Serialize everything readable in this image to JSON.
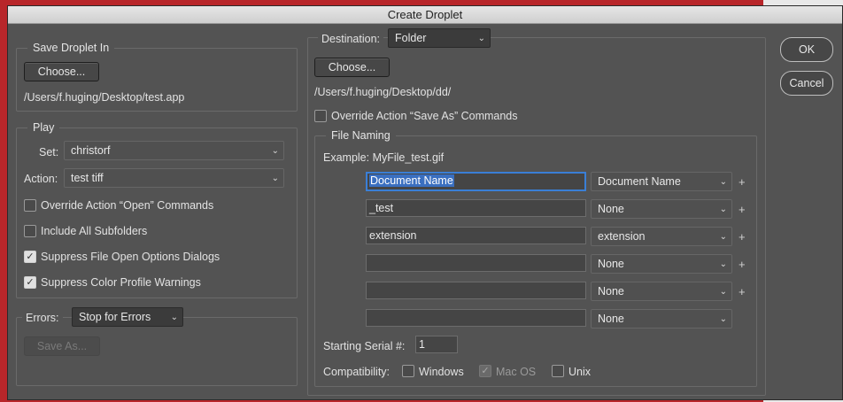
{
  "window": {
    "title": "Create Droplet"
  },
  "save_droplet": {
    "legend": "Save Droplet In",
    "choose_label": "Choose...",
    "path": "/Users/f.huging/Desktop/test.app"
  },
  "play": {
    "legend": "Play",
    "set_label": "Set:",
    "set_value": "christorf",
    "action_label": "Action:",
    "action_value": "test tiff",
    "override_open": "Override Action “Open” Commands",
    "include_subfolders": "Include All Subfolders",
    "suppress_open_options": "Suppress File Open Options Dialogs",
    "suppress_color_warnings": "Suppress Color Profile Warnings",
    "check_glyph": "✓"
  },
  "errors": {
    "label": "Errors:",
    "value": "Stop for Errors",
    "save_as_label": "Save As..."
  },
  "destination": {
    "label": "Destination:",
    "value": "Folder",
    "choose_label": "Choose...",
    "path": "/Users/f.huging/Desktop/dd/",
    "override_save_as": "Override Action “Save As” Commands"
  },
  "file_naming": {
    "legend": "File Naming",
    "example": "Example: MyFile_test.gif",
    "rows": [
      {
        "text": "Document Name",
        "option": "Document Name",
        "plus": "+"
      },
      {
        "text": "_test",
        "option": "None",
        "plus": "+"
      },
      {
        "text": "extension",
        "option": "extension",
        "plus": "+"
      },
      {
        "text": "",
        "option": "None",
        "plus": "+"
      },
      {
        "text": "",
        "option": "None",
        "plus": "+"
      },
      {
        "text": "",
        "option": "None",
        "plus": ""
      }
    ],
    "serial_label": "Starting Serial #:",
    "serial_value": "1",
    "compat_label": "Compatibility:",
    "compat_windows": "Windows",
    "compat_macos": "Mac OS",
    "compat_unix": "Unix"
  },
  "buttons": {
    "ok": "OK",
    "cancel": "Cancel"
  },
  "caret_glyph": "⌄"
}
